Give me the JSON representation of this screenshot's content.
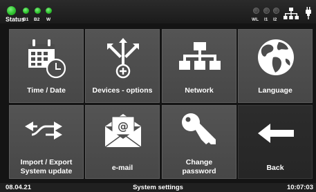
{
  "status_bar": {
    "status_label": "Status",
    "indicators_left": [
      "B1",
      "B2",
      "W"
    ],
    "indicators_right": [
      "WL",
      "I1",
      "I2"
    ],
    "active_color": "#2fc42f",
    "inactive_color": "#3a3a3a"
  },
  "tiles": [
    {
      "label_lines": [
        "Time / Date"
      ],
      "icon": "calendar-clock-icon"
    },
    {
      "label_lines": [
        "Devices - options"
      ],
      "icon": "branch-arrows-plus-icon"
    },
    {
      "label_lines": [
        "Network"
      ],
      "icon": "network-tree-icon"
    },
    {
      "label_lines": [
        "Language"
      ],
      "icon": "globe-icon"
    },
    {
      "label_lines": [
        "Import / Export",
        "System update"
      ],
      "icon": "swap-arrows-icon"
    },
    {
      "label_lines": [
        "e-mail"
      ],
      "icon": "envelope-icon"
    },
    {
      "label_lines": [
        "Change",
        "password"
      ],
      "icon": "key-icon"
    },
    {
      "label_lines": [
        "Back"
      ],
      "icon": "arrow-left-icon"
    }
  ],
  "footer": {
    "date": "08.04.21",
    "title": "System settings",
    "time": "10:07:03"
  }
}
